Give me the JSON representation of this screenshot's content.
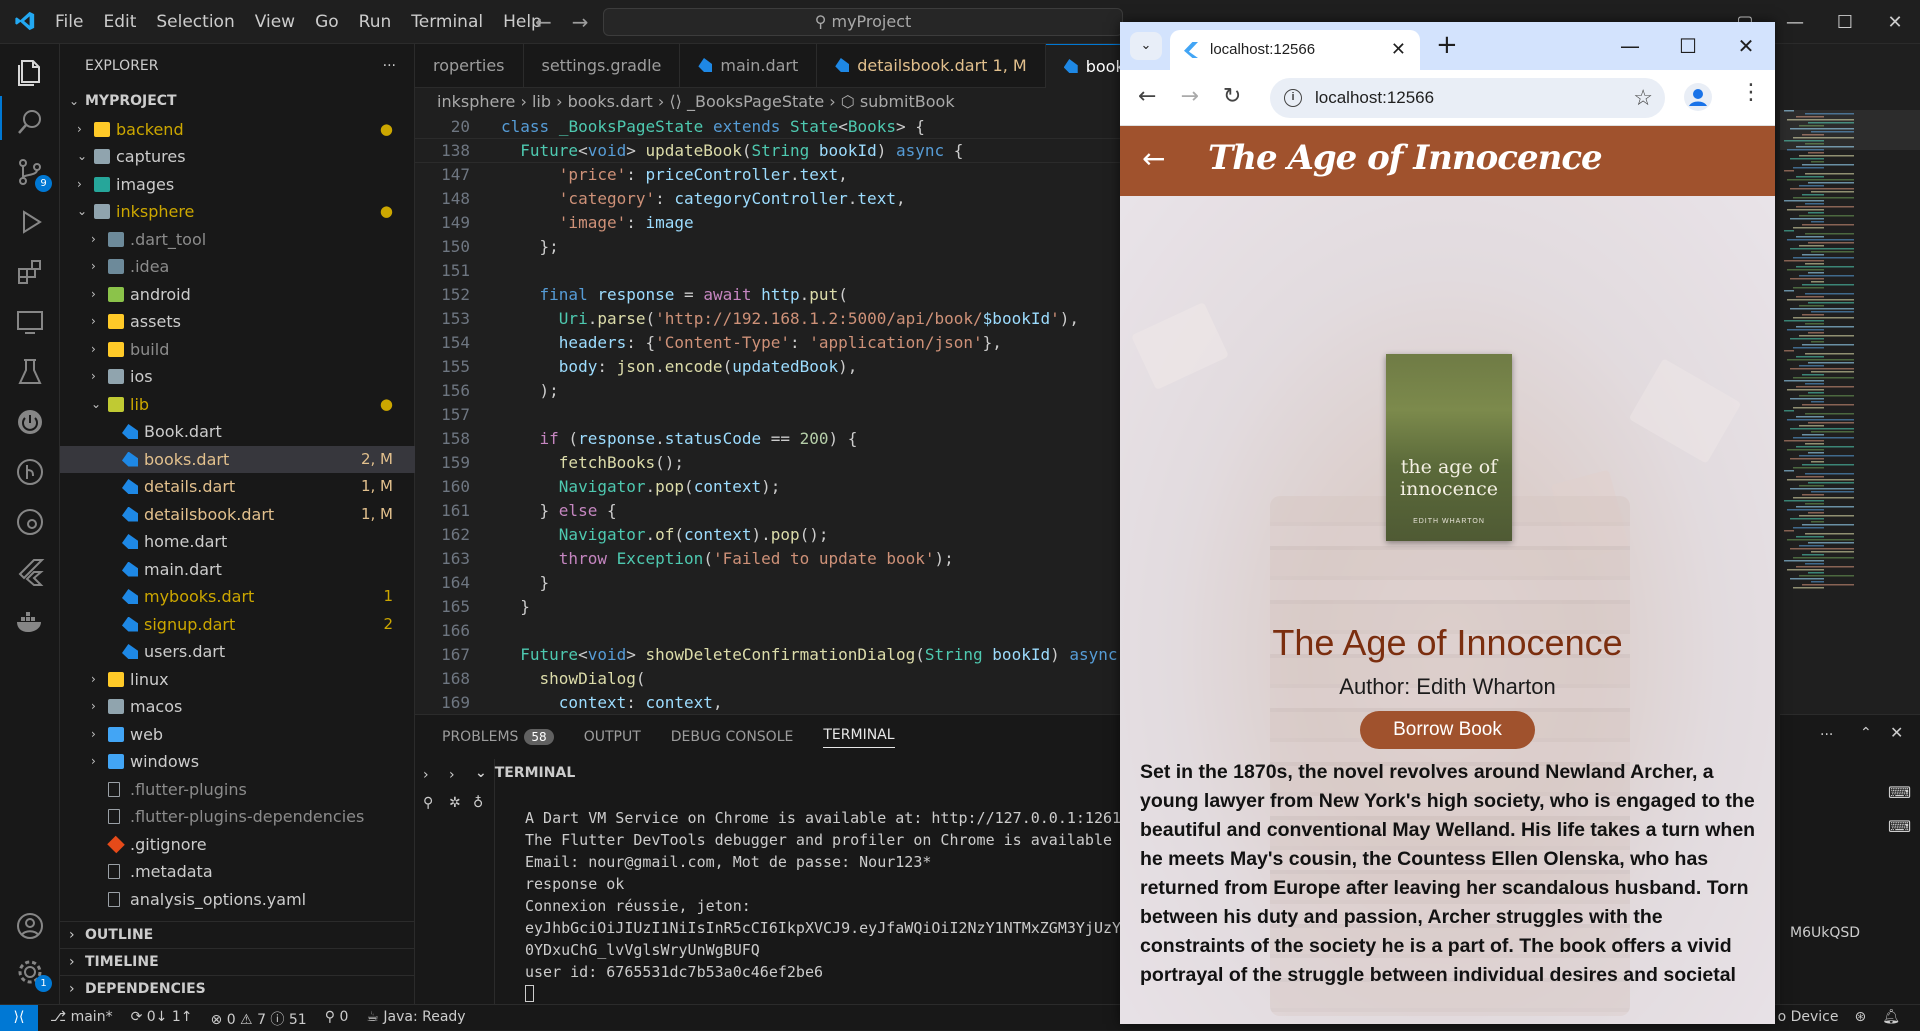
{
  "titlebar": {
    "menu": [
      "File",
      "Edit",
      "Selection",
      "View",
      "Go",
      "Run",
      "Terminal",
      "Help"
    ],
    "command_center": "⚲ myProject"
  },
  "activity_badges": {
    "source_control": "9",
    "accounts": "1"
  },
  "explorer": {
    "header": "EXPLORER",
    "more": "···",
    "project": "MYPROJECT",
    "items": [
      {
        "label": "backend",
        "depth": 1,
        "kind": "folder",
        "open": false,
        "color": "#cca700",
        "decoration": "●",
        "folder_color": "#ffca28"
      },
      {
        "label": "captures",
        "depth": 1,
        "kind": "folder",
        "open": true,
        "color": "#cccccc",
        "decoration": "",
        "folder_color": "#90a4ae"
      },
      {
        "label": "images",
        "depth": 1,
        "kind": "folder",
        "open": false,
        "color": "#cccccc",
        "decoration": "",
        "folder_color": "#26a69a"
      },
      {
        "label": "inksphere",
        "depth": 1,
        "kind": "folder",
        "open": true,
        "color": "#cca700",
        "decoration": "●",
        "folder_color": "#90a4ae"
      },
      {
        "label": ".dart_tool",
        "depth": 2,
        "kind": "folder",
        "open": false,
        "color": "#8b8b8b",
        "decoration": "",
        "folder_color": "#6d8a9a"
      },
      {
        "label": ".idea",
        "depth": 2,
        "kind": "folder",
        "open": false,
        "color": "#8b8b8b",
        "decoration": "",
        "folder_color": "#6d8a9a"
      },
      {
        "label": "android",
        "depth": 2,
        "kind": "folder",
        "open": false,
        "color": "#cccccc",
        "decoration": "",
        "folder_color": "#8bc34a"
      },
      {
        "label": "assets",
        "depth": 2,
        "kind": "folder",
        "open": false,
        "color": "#cccccc",
        "decoration": "",
        "folder_color": "#ffca28"
      },
      {
        "label": "build",
        "depth": 2,
        "kind": "folder",
        "open": false,
        "color": "#8b8b8b",
        "decoration": "",
        "folder_color": "#ffca28"
      },
      {
        "label": "ios",
        "depth": 2,
        "kind": "folder",
        "open": false,
        "color": "#cccccc",
        "decoration": "",
        "folder_color": "#90a4ae"
      },
      {
        "label": "lib",
        "depth": 2,
        "kind": "folder",
        "open": true,
        "color": "#cca700",
        "decoration": "●",
        "folder_color": "#c0ca33"
      },
      {
        "label": "Book.dart",
        "depth": 3,
        "kind": "dart",
        "color": "#cccccc",
        "decoration": ""
      },
      {
        "label": "books.dart",
        "depth": 3,
        "kind": "dart",
        "color": "#e2c08d",
        "decoration": "2, M",
        "selected": true
      },
      {
        "label": "details.dart",
        "depth": 3,
        "kind": "dart",
        "color": "#e2c08d",
        "decoration": "1, M"
      },
      {
        "label": "detailsbook.dart",
        "depth": 3,
        "kind": "dart",
        "color": "#e2c08d",
        "decoration": "1, M"
      },
      {
        "label": "home.dart",
        "depth": 3,
        "kind": "dart",
        "color": "#cccccc",
        "decoration": ""
      },
      {
        "label": "main.dart",
        "depth": 3,
        "kind": "dart",
        "color": "#cccccc",
        "decoration": ""
      },
      {
        "label": "mybooks.dart",
        "depth": 3,
        "kind": "dart",
        "color": "#cca700",
        "decoration": "1"
      },
      {
        "label": "signup.dart",
        "depth": 3,
        "kind": "dart",
        "color": "#cca700",
        "decoration": "2"
      },
      {
        "label": "users.dart",
        "depth": 3,
        "kind": "dart",
        "color": "#cccccc",
        "decoration": ""
      },
      {
        "label": "linux",
        "depth": 2,
        "kind": "folder",
        "open": false,
        "color": "#cccccc",
        "decoration": "",
        "folder_color": "#ffca28"
      },
      {
        "label": "macos",
        "depth": 2,
        "kind": "folder",
        "open": false,
        "color": "#cccccc",
        "decoration": "",
        "folder_color": "#90a4ae"
      },
      {
        "label": "web",
        "depth": 2,
        "kind": "folder",
        "open": false,
        "color": "#cccccc",
        "decoration": "",
        "folder_color": "#42a5f5"
      },
      {
        "label": "windows",
        "depth": 2,
        "kind": "folder",
        "open": false,
        "color": "#cccccc",
        "decoration": "",
        "folder_color": "#42a5f5"
      },
      {
        "label": ".flutter-plugins",
        "depth": 2,
        "kind": "file",
        "color": "#8b8b8b",
        "decoration": ""
      },
      {
        "label": ".flutter-plugins-dependencies",
        "depth": 2,
        "kind": "file",
        "color": "#8b8b8b",
        "decoration": ""
      },
      {
        "label": ".gitignore",
        "depth": 2,
        "kind": "git",
        "color": "#cccccc",
        "decoration": ""
      },
      {
        "label": ".metadata",
        "depth": 2,
        "kind": "file",
        "color": "#cccccc",
        "decoration": ""
      },
      {
        "label": "analysis_options.yaml",
        "depth": 2,
        "kind": "file",
        "color": "#cccccc",
        "decoration": ""
      }
    ],
    "sections": [
      "OUTLINE",
      "TIMELINE",
      "DEPENDENCIES"
    ]
  },
  "editor": {
    "tabs": [
      {
        "label": "roperties",
        "dart": false,
        "active": false
      },
      {
        "label": "settings.gradle",
        "dart": false,
        "active": false
      },
      {
        "label": "main.dart",
        "dart": true,
        "active": false
      },
      {
        "label": "detailsbook.dart  1, M",
        "dart": true,
        "active": false,
        "modified": true
      },
      {
        "label": "books.dart",
        "dart": true,
        "active": true
      }
    ],
    "breadcrumb": "inksphere › lib › books.dart › ⟨⟩ _BooksPageState › ⬡ submitBook",
    "lines": [
      {
        "n": "20",
        "sticky": true,
        "html": "<span class='kw'>class</span> <span class='ty'>_BooksPageState</span> <span class='kw'>extends</span> <span class='ty'>State</span>&lt;<span class='ty'>Books</span>&gt; {"
      },
      {
        "n": "138",
        "sticky": true,
        "html": "  <span class='ty'>Future</span>&lt;<span class='kw'>void</span>&gt; <span class='fn'>updateBook</span>(<span class='ty'>String</span> <span class='vr'>bookId</span>) <span class='kw'>async</span> {"
      },
      {
        "n": "147",
        "html": "      <span class='st'>'price'</span>: <span class='vr'>priceController</span>.<span class='vr'>text</span>,"
      },
      {
        "n": "148",
        "html": "      <span class='st'>'category'</span>: <span class='vr'>categoryController</span>.<span class='vr'>text</span>,"
      },
      {
        "n": "149",
        "html": "      <span class='st'>'image'</span>: <span class='vr'>image</span>"
      },
      {
        "n": "150",
        "html": "    };"
      },
      {
        "n": "151",
        "html": ""
      },
      {
        "n": "152",
        "html": "    <span class='kw'>final</span> <span class='vr'>response</span> = <span class='ctl'>await</span> <span class='vr'>http</span>.<span class='fn'>put</span>("
      },
      {
        "n": "153",
        "html": "      <span class='ty'>Uri</span>.<span class='fn'>parse</span>(<span class='st'>'http://192.168.1.2:5000/api/book/</span><span class='vr'>$bookId</span><span class='st'>'</span>),"
      },
      {
        "n": "154",
        "html": "      <span class='vr'>headers</span>: {<span class='st'>'Content-Type'</span>: <span class='st'>'application/json'</span>},"
      },
      {
        "n": "155",
        "html": "      <span class='vr'>body</span>: <span class='fn'>json</span>.<span class='fn'>encode</span>(<span class='vr'>updatedBook</span>),"
      },
      {
        "n": "156",
        "html": "    );"
      },
      {
        "n": "157",
        "html": ""
      },
      {
        "n": "158",
        "html": "    <span class='ctl'>if</span> (<span class='vr'>response</span>.<span class='vr'>statusCode</span> == <span class='nm'>200</span>) {"
      },
      {
        "n": "159",
        "html": "      <span class='fn'>fetchBooks</span>();"
      },
      {
        "n": "160",
        "html": "      <span class='ty'>Navigator</span>.<span class='fn'>pop</span>(<span class='vr'>context</span>);"
      },
      {
        "n": "161",
        "html": "    } <span class='ctl'>else</span> {"
      },
      {
        "n": "162",
        "html": "      <span class='ty'>Navigator</span>.<span class='fn'>of</span>(<span class='vr'>context</span>).<span class='fn'>pop</span>();"
      },
      {
        "n": "163",
        "html": "      <span class='ctl'>throw</span> <span class='ty'>Exception</span>(<span class='st'>'Failed to update book'</span>);"
      },
      {
        "n": "164",
        "html": "    }"
      },
      {
        "n": "165",
        "html": "  }"
      },
      {
        "n": "166",
        "html": ""
      },
      {
        "n": "167",
        "html": "  <span class='ty'>Future</span>&lt;<span class='kw'>void</span>&gt; <span class='fn'>showDeleteConfirmationDialog</span>(<span class='ty'>String</span> <span class='vr'>bookId</span>) <span class='kw'>async</span>"
      },
      {
        "n": "168",
        "html": "    <span class='fn'>showDialog</span>("
      },
      {
        "n": "169",
        "html": "      <span class='vr'>context</span>: <span class='vr'>context</span>,"
      }
    ]
  },
  "panel": {
    "tabs": [
      "PROBLEMS",
      "OUTPUT",
      "DEBUG CONSOLE",
      "TERMINAL"
    ],
    "problems_count": "58",
    "terminal_header": "TERMINAL",
    "terminal_lines": [
      "A Dart VM Service on Chrome is available at: http://127.0.0.1:1261",
      "The Flutter DevTools debugger and profiler on Chrome is available",
      "Email: nour@gmail.com, Mot de passe: Nour123*",
      "response ok",
      "Connexion réussie, jeton:",
      "eyJhbGciOiJIUzI1NiIsInR5cCI6IkpXVCJ9.eyJfaWQiOiI2NzY1NTMxZGM3YjUzY",
      "0YDxuChG_lvVglsWryUnWgBUFQ",
      "user id: 6765531dc7b53a0c46ef2be6"
    ],
    "right_overflow": "M6UkQSD"
  },
  "statusbar": {
    "branch": "main*",
    "sync": "0↓ 1↑",
    "errors": "0",
    "warnings": "7",
    "infos": "51",
    "ports": "0",
    "java": "Java: Ready",
    "device": "o Device"
  },
  "browser": {
    "tab_title": "localhost:12566",
    "url": "localhost:12566"
  },
  "app": {
    "appbar_title": "The Age of Innocence",
    "cover_title": "the age of innocence",
    "cover_author": "EDITH WHARTON",
    "book_title": "The Age of Innocence",
    "author": "Author: Edith Wharton",
    "borrow_label": "Borrow Book",
    "description": "Set in the 1870s, the novel revolves around Newland Archer, a young lawyer from New York's high society, who is engaged to the beautiful and conventional May Welland. His life takes a turn when he meets May's cousin, the Countess Ellen Olenska, who has returned from Europe after leaving her scandalous husband. Torn between his duty and passion, Archer struggles with the constraints of the society he is a part of. The book offers a vivid portrayal of the struggle between individual desires and societal",
    "accent_color": "#a0522d"
  }
}
